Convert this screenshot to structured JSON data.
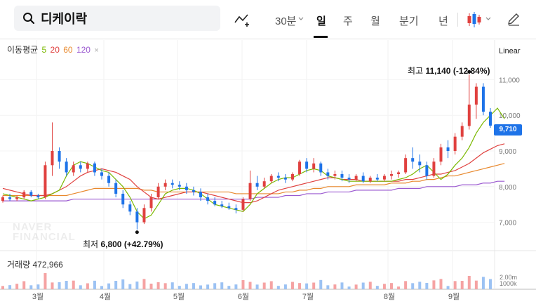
{
  "search": {
    "term": "디케이락"
  },
  "periods": [
    {
      "label": "30분",
      "active": false
    },
    {
      "label": "일",
      "active": true
    },
    {
      "label": "주",
      "active": false
    },
    {
      "label": "월",
      "active": false
    },
    {
      "label": "분기",
      "active": false
    },
    {
      "label": "년",
      "active": false
    }
  ],
  "toolbar_icons": [
    "chart-indicator-add-icon",
    "chevron-down-icon",
    "candlestick-type-icon",
    "pencil-draw-icon"
  ],
  "legend": {
    "title": "이동평균",
    "items": [
      {
        "label": "5",
        "color": "#7ab800"
      },
      {
        "label": "20",
        "color": "#e0413f"
      },
      {
        "label": "60",
        "color": "#e8882c"
      },
      {
        "label": "120",
        "color": "#9b59d0"
      }
    ],
    "close_symbol": "×"
  },
  "scale_mode": "Linear",
  "volume": {
    "label": "거래량",
    "value": "472,966"
  },
  "watermark": [
    "NAVER",
    "FINANCIAL"
  ],
  "high_annotation": {
    "label": "최고",
    "value": "11,140",
    "change": "(-12.84%)"
  },
  "low_annotation": {
    "label": "최저",
    "value": "6,800",
    "change": "(+42.79%)"
  },
  "current_price": "9,710",
  "colors": {
    "up": "#e0413f",
    "down": "#1e73e8",
    "current_tag": "#1e73e8"
  },
  "chart_data": {
    "type": "candlestick",
    "price_axis": {
      "ticks": [
        "11,000",
        "10,000",
        "9,000",
        "8,000",
        "7,000"
      ],
      "tick_values": [
        11000,
        10000,
        9000,
        8000,
        7000
      ],
      "ylim": [
        6500,
        11500
      ]
    },
    "volume_axis": {
      "ticks": [
        "2.00m",
        "1000k"
      ]
    },
    "x_ticks": [
      "3월",
      "4월",
      "5월",
      "6월",
      "7월",
      "8월",
      "9월"
    ],
    "high": 11140,
    "low": 6800,
    "last": 9710,
    "moving_averages": [
      {
        "name": "5",
        "points": [
          7800,
          7750,
          7700,
          7650,
          7600,
          7650,
          7700,
          7800,
          7900,
          8300,
          8600,
          8700,
          8650,
          8550,
          8450,
          8400,
          8200,
          8000,
          7700,
          7300,
          7100,
          7200,
          7500,
          7800,
          7900,
          7950,
          7950,
          7900,
          7800,
          7650,
          7500,
          7450,
          7400,
          7350,
          7300,
          7500,
          7800,
          7950,
          8100,
          8200,
          8250,
          8250,
          8350,
          8450,
          8500,
          8450,
          8300,
          8250,
          8200,
          8150,
          8150,
          8150,
          8150,
          8150,
          8150,
          8150,
          8200,
          8250,
          8350,
          8500,
          8600,
          8400,
          8200,
          8350,
          8600,
          8800,
          9100,
          9500,
          9800,
          10000,
          10200,
          9900
        ]
      },
      {
        "name": "20",
        "points": [
          7950,
          7900,
          7850,
          7800,
          7750,
          7750,
          7750,
          7800,
          7900,
          8000,
          8150,
          8300,
          8400,
          8450,
          8500,
          8450,
          8400,
          8300,
          8200,
          8000,
          7850,
          7700,
          7650,
          7700,
          7750,
          7800,
          7850,
          7850,
          7850,
          7800,
          7750,
          7700,
          7650,
          7600,
          7550,
          7550,
          7600,
          7700,
          7800,
          7900,
          7950,
          8000,
          8050,
          8100,
          8150,
          8200,
          8250,
          8250,
          8200,
          8200,
          8200,
          8150,
          8150,
          8150,
          8150,
          8150,
          8150,
          8200,
          8200,
          8250,
          8300,
          8350,
          8350,
          8400,
          8450,
          8550,
          8650,
          8800,
          8950,
          9050,
          9150,
          9200
        ]
      },
      {
        "name": "60",
        "points": [
          7750,
          7750,
          7750,
          7750,
          7750,
          7750,
          7750,
          7750,
          7750,
          7750,
          7800,
          7850,
          7900,
          7950,
          7950,
          7950,
          7950,
          7950,
          7950,
          7950,
          7900,
          7900,
          7850,
          7850,
          7850,
          7850,
          7850,
          7850,
          7850,
          7850,
          7850,
          7850,
          7850,
          7800,
          7800,
          7800,
          7800,
          7800,
          7800,
          7800,
          7850,
          7850,
          7900,
          7900,
          7950,
          7950,
          8000,
          8000,
          8000,
          8000,
          8050,
          8050,
          8050,
          8050,
          8050,
          8100,
          8100,
          8100,
          8150,
          8150,
          8200,
          8200,
          8250,
          8300,
          8300,
          8350,
          8400,
          8450,
          8500,
          8550,
          8600,
          8650
        ]
      },
      {
        "name": "120",
        "points": [
          7600,
          7600,
          7600,
          7600,
          7600,
          7600,
          7600,
          7600,
          7600,
          7600,
          7650,
          7650,
          7650,
          7650,
          7650,
          7650,
          7650,
          7650,
          7650,
          7650,
          7650,
          7650,
          7650,
          7650,
          7650,
          7650,
          7650,
          7650,
          7650,
          7650,
          7650,
          7650,
          7650,
          7650,
          7650,
          7650,
          7700,
          7700,
          7700,
          7700,
          7750,
          7750,
          7750,
          7800,
          7800,
          7800,
          7850,
          7850,
          7850,
          7850,
          7900,
          7900,
          7900,
          7900,
          7900,
          7900,
          7950,
          7950,
          7950,
          7950,
          8000,
          8000,
          8000,
          8000,
          8000,
          8050,
          8050,
          8050,
          8100,
          8100,
          8150,
          8150
        ]
      }
    ],
    "candles": [
      [
        7600,
        7750,
        7550,
        7700
      ],
      [
        7700,
        7800,
        7600,
        7650
      ],
      [
        7650,
        7750,
        7600,
        7700
      ],
      [
        7700,
        7900,
        7650,
        7850
      ],
      [
        7850,
        7900,
        7700,
        7750
      ],
      [
        7750,
        7800,
        7650,
        7700
      ],
      [
        7700,
        8700,
        7650,
        8600
      ],
      [
        8600,
        9800,
        8300,
        9000
      ],
      [
        9000,
        9100,
        8500,
        8700
      ],
      [
        8700,
        8800,
        8300,
        8400
      ],
      [
        8400,
        8700,
        8300,
        8600
      ],
      [
        8600,
        8700,
        8400,
        8500
      ],
      [
        8500,
        8700,
        8400,
        8650
      ],
      [
        8650,
        8700,
        8300,
        8400
      ],
      [
        8400,
        8500,
        8200,
        8300
      ],
      [
        8300,
        8400,
        8000,
        8100
      ],
      [
        8100,
        8200,
        7700,
        7800
      ],
      [
        7800,
        7900,
        7400,
        7500
      ],
      [
        7500,
        7600,
        7200,
        7300
      ],
      [
        7300,
        7400,
        6800,
        7000
      ],
      [
        7000,
        7500,
        6950,
        7400
      ],
      [
        7400,
        7800,
        7300,
        7700
      ],
      [
        7700,
        8100,
        7650,
        8000
      ],
      [
        8000,
        8200,
        7900,
        8100
      ],
      [
        8100,
        8200,
        7950,
        8050
      ],
      [
        8050,
        8150,
        7900,
        8000
      ],
      [
        8000,
        8100,
        7800,
        7900
      ],
      [
        7900,
        8000,
        7750,
        7850
      ],
      [
        7850,
        7950,
        7600,
        7700
      ],
      [
        7700,
        7800,
        7500,
        7600
      ],
      [
        7600,
        7700,
        7450,
        7500
      ],
      [
        7500,
        7600,
        7400,
        7450
      ],
      [
        7450,
        7550,
        7350,
        7400
      ],
      [
        7400,
        7500,
        7250,
        7350
      ],
      [
        7350,
        7700,
        7300,
        7650
      ],
      [
        7650,
        8450,
        7600,
        8100
      ],
      [
        8100,
        8300,
        7900,
        8000
      ],
      [
        8000,
        8250,
        7950,
        8150
      ],
      [
        8150,
        8350,
        8100,
        8300
      ],
      [
        8300,
        8400,
        8150,
        8250
      ],
      [
        8250,
        8350,
        8100,
        8200
      ],
      [
        8200,
        8400,
        8150,
        8350
      ],
      [
        8350,
        8750,
        8300,
        8700
      ],
      [
        8700,
        8800,
        8400,
        8500
      ],
      [
        8500,
        8800,
        8400,
        8650
      ],
      [
        8650,
        8700,
        8300,
        8400
      ],
      [
        8400,
        8500,
        8200,
        8300
      ],
      [
        8300,
        8450,
        8200,
        8350
      ],
      [
        8350,
        8450,
        8150,
        8250
      ],
      [
        8250,
        8350,
        8100,
        8200
      ],
      [
        8200,
        8350,
        8150,
        8300
      ],
      [
        8300,
        8400,
        8100,
        8150
      ],
      [
        8150,
        8300,
        8100,
        8250
      ],
      [
        8250,
        8350,
        8150,
        8200
      ],
      [
        8200,
        8350,
        8150,
        8300
      ],
      [
        8300,
        8450,
        8200,
        8350
      ],
      [
        8350,
        8450,
        8250,
        8400
      ],
      [
        8400,
        8900,
        8350,
        8800
      ],
      [
        8800,
        9100,
        8500,
        8700
      ],
      [
        8700,
        8900,
        8400,
        8600
      ],
      [
        8600,
        8700,
        8200,
        8300
      ],
      [
        8300,
        8800,
        8250,
        8700
      ],
      [
        8700,
        9200,
        8600,
        9100
      ],
      [
        9100,
        9300,
        8800,
        9000
      ],
      [
        9000,
        9500,
        8900,
        9400
      ],
      [
        9400,
        9800,
        9300,
        9700
      ],
      [
        9700,
        11140,
        9600,
        10300
      ],
      [
        10300,
        10900,
        9900,
        10800
      ],
      [
        10800,
        10900,
        10000,
        10100
      ],
      [
        10100,
        10200,
        9650,
        9710
      ]
    ]
  }
}
